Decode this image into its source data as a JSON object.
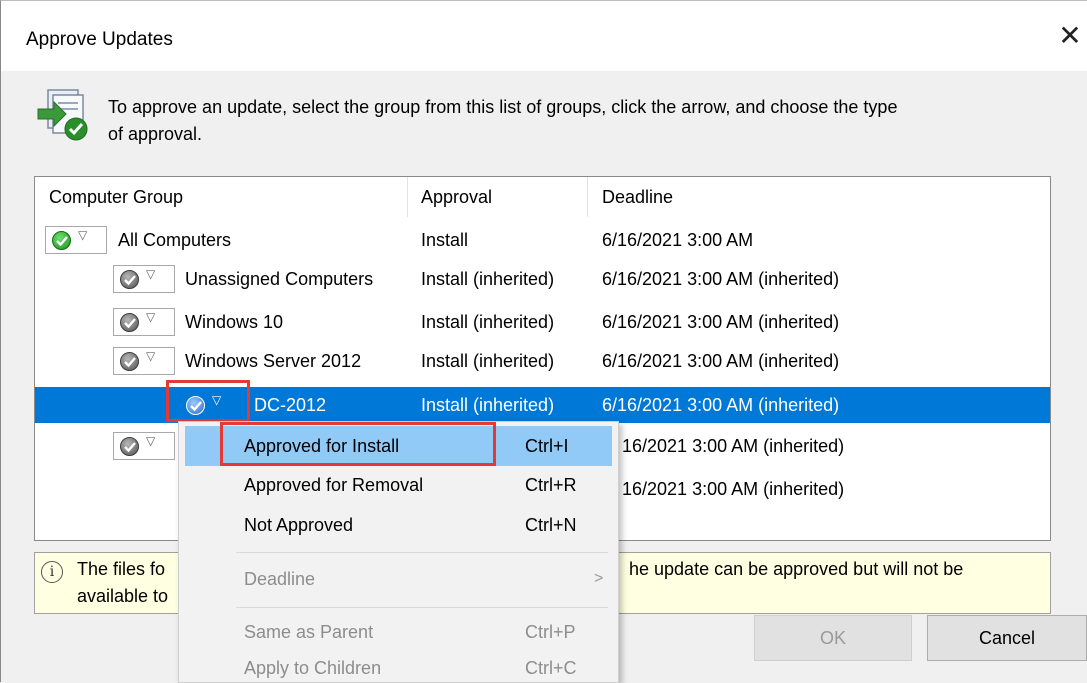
{
  "dialog": {
    "title": "Approve Updates",
    "instruction_line1": "To approve an update, select the group from this list of groups, click the arrow, and choose the type",
    "instruction_line2": "of approval."
  },
  "grid": {
    "columns": [
      "Computer Group",
      "Approval",
      "Deadline"
    ],
    "rows": [
      {
        "group": "All Computers",
        "approval": "Install",
        "deadline": "6/16/2021 3:00 AM",
        "status_color": "green"
      },
      {
        "group": "Unassigned Computers",
        "approval": "Install (inherited)",
        "deadline": "6/16/2021 3:00 AM (inherited)",
        "status_color": "gray"
      },
      {
        "group": "Windows 10",
        "approval": "Install (inherited)",
        "deadline": "6/16/2021 3:00 AM (inherited)",
        "status_color": "gray"
      },
      {
        "group": "Windows Server 2012",
        "approval": "Install (inherited)",
        "deadline": "6/16/2021 3:00 AM (inherited)",
        "status_color": "gray"
      },
      {
        "group": "DC-2012",
        "approval": "Install (inherited)",
        "deadline": "6/16/2021 3:00 AM (inherited)",
        "status_color": "blue",
        "selected": true
      },
      {
        "group": "",
        "approval": "",
        "deadline": "16/2021 3:00 AM (inherited)",
        "status_color": "gray"
      },
      {
        "group": "",
        "approval": "",
        "deadline": "16/2021 3:00 AM (inherited)"
      }
    ]
  },
  "context_menu": {
    "items": [
      {
        "label": "Approved for Install",
        "shortcut": "Ctrl+I"
      },
      {
        "label": "Approved for Removal",
        "shortcut": "Ctrl+R"
      },
      {
        "label": "Not Approved",
        "shortcut": "Ctrl+N"
      },
      {
        "label": "Deadline",
        "arrow": ">"
      },
      {
        "label": "Same as Parent",
        "shortcut": "Ctrl+P"
      },
      {
        "label": "Apply to Children",
        "shortcut": "Ctrl+C"
      }
    ]
  },
  "info": {
    "icon": "i",
    "text_line1_start": "The files fo",
    "text_line2_start": "available to",
    "text_line1_end": "he update can be approved but will not be"
  },
  "buttons": {
    "ok": "OK",
    "cancel": "Cancel"
  },
  "colors": {
    "selection": "#0078d7",
    "menu_highlight": "#91c9f7",
    "callout": "#e53935",
    "info_bg": "#ffffe1"
  }
}
